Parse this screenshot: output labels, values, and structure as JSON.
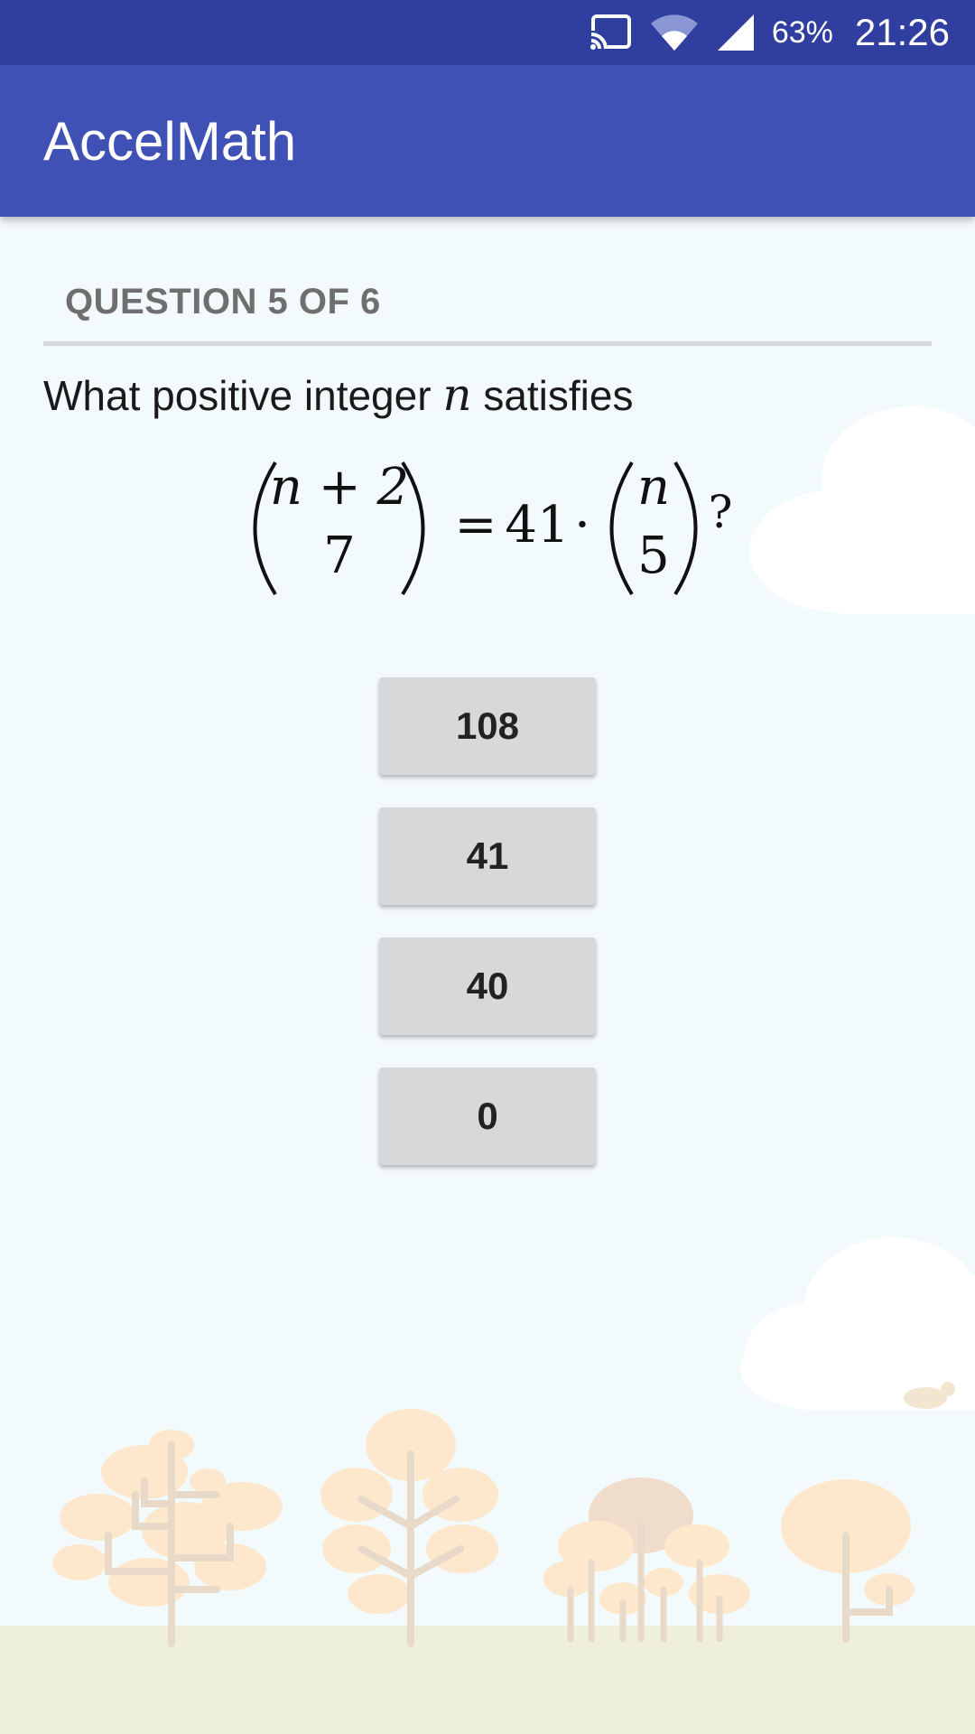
{
  "status_bar": {
    "battery_text": "63%",
    "time": "21:26",
    "icons": [
      "cast-icon",
      "wifi-icon",
      "cell-signal-icon"
    ]
  },
  "app_bar": {
    "title": "AccelMath"
  },
  "quiz": {
    "header": "QUESTION 5 OF 6",
    "question_prefix": "What positive integer",
    "question_variable": "n",
    "question_suffix": "satisfies",
    "formula": {
      "lhs_top": "n + 2",
      "lhs_bottom": "7",
      "equals": "=",
      "coefficient": "41",
      "dot": "·",
      "rhs_top": "n",
      "rhs_bottom": "5",
      "end": "?"
    },
    "answers": [
      "108",
      "41",
      "40",
      "0"
    ]
  },
  "colors": {
    "status_bar": "#303f9f",
    "app_bar": "#3f51b5",
    "background": "#f3fafc",
    "button": "#d7d8d9",
    "ground": "#eef0dc"
  }
}
